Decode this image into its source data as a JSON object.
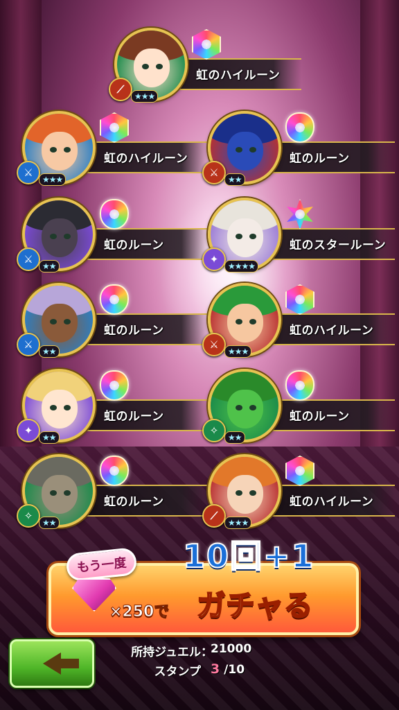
{
  "results": [
    {
      "name": "虹のハイルーン",
      "gem": "hex",
      "stars": "★★★",
      "type": "bow",
      "hair": "#7a3a22",
      "face": "#ffe2cc",
      "ring": "#1a8a4a",
      "badge": "#b8321a",
      "badge_icon": "⟋"
    },
    {
      "name": "虹のハイルーン",
      "gem": "hex",
      "stars": "★★★",
      "type": "axe",
      "hair": "#e2642a",
      "face": "#f7c9a4",
      "ring": "#2b7fc4",
      "badge": "#1e6fcf",
      "badge_icon": "⚔"
    },
    {
      "name": "虹のルーン",
      "gem": "drop",
      "stars": "★★",
      "type": "sword",
      "hair": "#1a2f8a",
      "face": "#2a4bb8",
      "ring": "#b83030",
      "badge": "#b8321a",
      "badge_icon": "⚔"
    },
    {
      "name": "虹のルーン",
      "gem": "drop",
      "stars": "★★",
      "type": "axe",
      "hair": "#2b2b33",
      "face": "#4a4050",
      "ring": "#7b4bd6",
      "badge": "#1e6fcf",
      "badge_icon": "⚔"
    },
    {
      "name": "虹のスタールーン",
      "gem": "star",
      "stars": "★★★★",
      "type": "staff",
      "hair": "#e8e4dc",
      "face": "#f3ebe6",
      "ring": "#9a7bd6",
      "badge": "#7b4bd6",
      "badge_icon": "✦"
    },
    {
      "name": "虹のルーン",
      "gem": "drop",
      "stars": "★★",
      "type": "axe",
      "hair": "#b7a6d9",
      "face": "#8a5a3a",
      "ring": "#2b7fc4",
      "badge": "#1e6fcf",
      "badge_icon": "⚔"
    },
    {
      "name": "虹のハイルーン",
      "gem": "hex",
      "stars": "★★★",
      "type": "sword",
      "hair": "#2a9a3a",
      "face": "#f6c7a0",
      "ring": "#b83030",
      "badge": "#b8321a",
      "badge_icon": "⚔"
    },
    {
      "name": "虹のルーン",
      "gem": "drop",
      "stars": "★★",
      "type": "staff",
      "hair": "#f1d27a",
      "face": "#ffe6d0",
      "ring": "#7b4bd6",
      "badge": "#7b4bd6",
      "badge_icon": "✦"
    },
    {
      "name": "虹のルーン",
      "gem": "drop",
      "stars": "★★",
      "type": "spear",
      "hair": "#2a8a2a",
      "face": "#4fc24a",
      "ring": "#1a8a4a",
      "badge": "#1a8a4a",
      "badge_icon": "✧"
    },
    {
      "name": "虹のルーン",
      "gem": "drop",
      "stars": "★★",
      "type": "spear",
      "hair": "#6a6a60",
      "face": "#9a8f7a",
      "ring": "#1a8a4a",
      "badge": "#1a8a4a",
      "badge_icon": "✧"
    },
    {
      "name": "虹のハイルーン",
      "gem": "hex",
      "stars": "★★★",
      "type": "bow",
      "hair": "#e2782a",
      "face": "#f6d4b8",
      "ring": "#b83030",
      "badge": "#b8321a",
      "badge_icon": "⟋"
    }
  ],
  "gacha_button": {
    "again_label": "もう一度",
    "count_label": "10回+1",
    "cost_label": "×250で",
    "action_label": "ガチャる"
  },
  "back_button": {
    "icon": "back-arrow-icon"
  },
  "info": {
    "jewel_label": "所持ジュエル",
    "jewel_value": "21000",
    "stamp_label": "スタンプ",
    "stamp_current": "3",
    "stamp_total": "/10"
  }
}
